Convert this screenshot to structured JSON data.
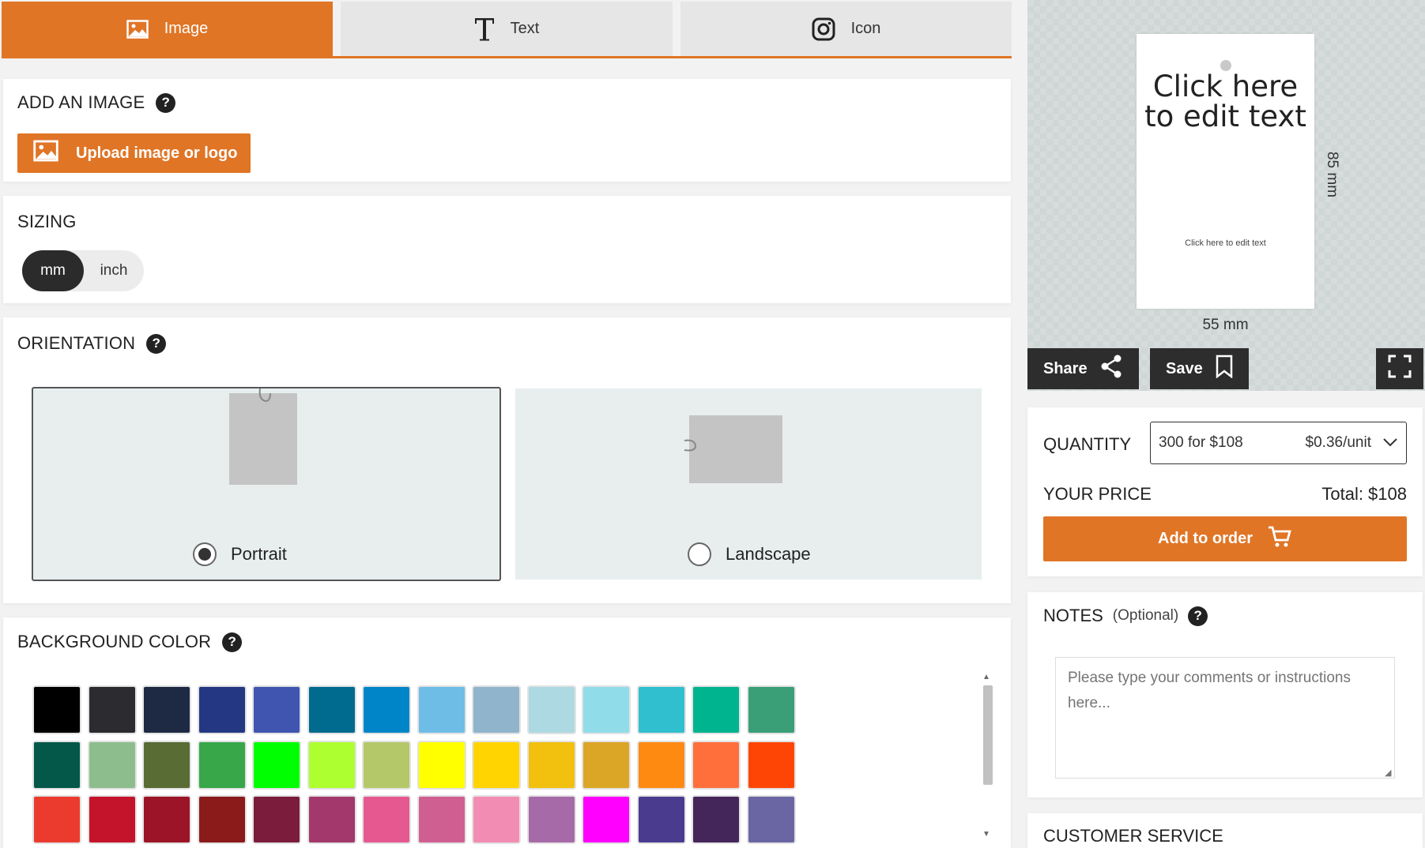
{
  "tabs": [
    {
      "label": "Image",
      "icon": "image-icon",
      "active": true
    },
    {
      "label": "Text",
      "icon": "text-icon",
      "active": false
    },
    {
      "label": "Icon",
      "icon": "instagram-icon",
      "active": false
    }
  ],
  "add_image": {
    "title": "ADD AN IMAGE",
    "upload_label": "Upload image or logo"
  },
  "sizing": {
    "title": "SIZING",
    "options": [
      "mm",
      "inch"
    ],
    "selected": "mm"
  },
  "orientation": {
    "title": "ORIENTATION",
    "options": [
      {
        "label": "Portrait",
        "selected": true
      },
      {
        "label": "Landscape",
        "selected": false
      }
    ]
  },
  "background_color": {
    "title": "BACKGROUND COLOR",
    "swatches": [
      [
        "#000000",
        "#2b2b30",
        "#1e2a44",
        "#233782",
        "#3f55b0",
        "#006b8e",
        "#0086c8",
        "#6ebde6",
        "#8fb4cc",
        "#add9e3",
        "#90dde9",
        "#2fbfce",
        "#00b48f",
        "#3a9e76"
      ],
      [
        "#03584a",
        "#8dbd8c",
        "#586c34",
        "#37a74a",
        "#00ff00",
        "#adff2f",
        "#b4c86a",
        "#ffff00",
        "#ffd400",
        "#f2c00f",
        "#dba526",
        "#ff8a12",
        "#ff6f3c",
        "#ff4506"
      ],
      [
        "#eb3b2f",
        "#c4142c",
        "#9b1427",
        "#8b1a1a",
        "#7b1c3c",
        "#a2386b",
        "#e65890",
        "#cf5f91",
        "#f28cb3",
        "#a66aa8",
        "#ff00ff",
        "#4b3b8e",
        "#45265a",
        "#6a66a3"
      ]
    ]
  },
  "preview": {
    "headline": "Click here to edit text",
    "subtext": "Click here to edit text",
    "width_label": "55 mm",
    "height_label": "85 mm",
    "share_label": "Share",
    "save_label": "Save"
  },
  "pricing": {
    "quantity_label": "QUANTITY",
    "quantity_value": "300 for $108",
    "unit_price": "$0.36/unit",
    "your_price_label": "YOUR PRICE",
    "total": "Total: $108",
    "add_to_order_label": "Add to order"
  },
  "notes": {
    "title": "NOTES",
    "optional": "(Optional)",
    "placeholder": "Please type your comments or instructions here..."
  },
  "customer_service": {
    "title": "CUSTOMER SERVICE"
  },
  "colors": {
    "accent": "#e07526",
    "dark": "#2d2d2d"
  }
}
